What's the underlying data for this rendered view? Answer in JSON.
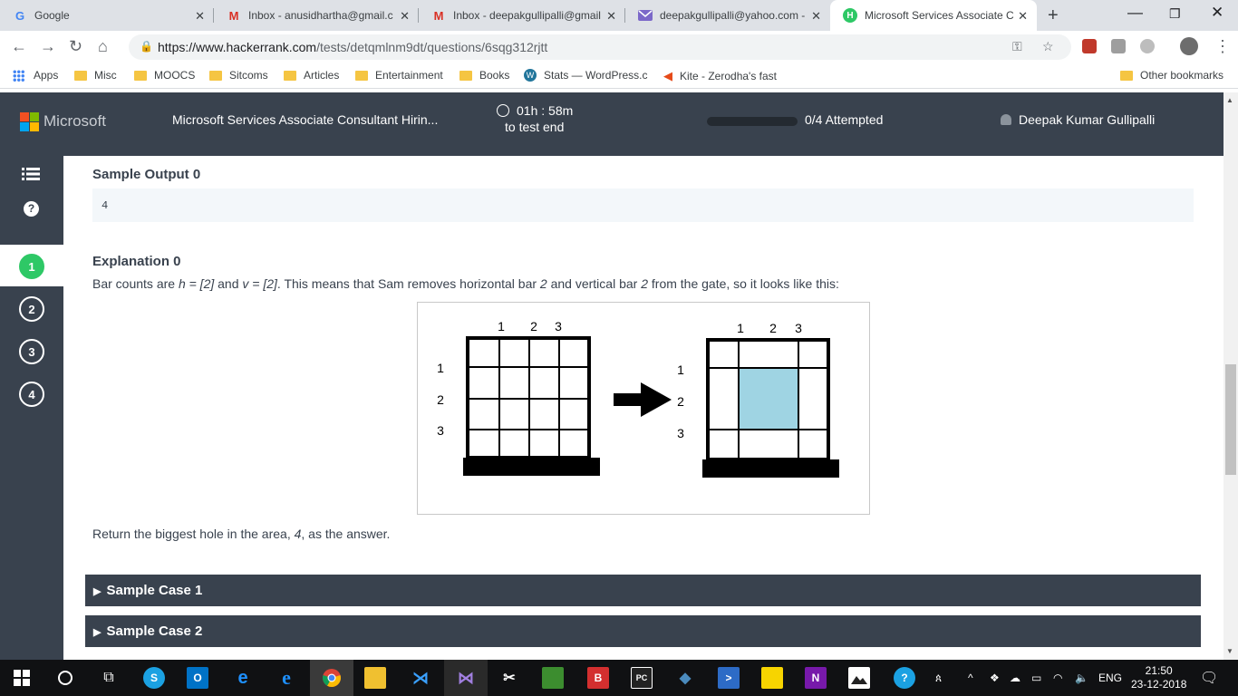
{
  "browser": {
    "tabs": [
      {
        "title": "Google",
        "icon": "google-g-icon"
      },
      {
        "title": "Inbox - anusidhartha@gmail.co",
        "icon": "gmail-icon"
      },
      {
        "title": "Inbox - deepakgullipalli@gmail",
        "icon": "gmail-icon"
      },
      {
        "title": "deepakgullipalli@yahoo.com -",
        "icon": "yahoo-mail-icon"
      },
      {
        "title": "Microsoft Services Associate C",
        "icon": "hackerrank-icon"
      }
    ],
    "url_host": "https://www.hackerrank.com",
    "url_path": "/tests/detqmlnm9dt/questions/6sqg312rjtt",
    "bookmarks": [
      "Apps",
      "Misc",
      "MOOCS",
      "Sitcoms",
      "Articles",
      "Entertainment",
      "Books",
      "Stats — WordPress.c",
      "Kite - Zerodha's fast"
    ],
    "other_bookmarks": "Other bookmarks"
  },
  "header": {
    "brand": "Microsoft",
    "test_title": "Microsoft Services Associate Consultant Hirin...",
    "timer": "01h : 58m",
    "timer_sub": "to test end",
    "progress": 0.0,
    "attempted": "0/4 Attempted",
    "user": "Deepak Kumar Gullipalli"
  },
  "sidebar": {
    "questions": [
      "1",
      "2",
      "3",
      "4"
    ],
    "active_question": "1"
  },
  "main": {
    "sample_output_title": "Sample Output 0",
    "sample_output_value": "4",
    "explanation_title": "Explanation 0",
    "explanation_parts": {
      "p1": "Bar counts are ",
      "h": "h = [2]",
      "p2": " and ",
      "v": "v = [2]",
      "p3": ". This means that Sam removes horizontal bar ",
      "n1": "2",
      "p4": " and vertical bar ",
      "n2": "2",
      "p5": " from the gate, so it looks like this:"
    },
    "figure": {
      "col_labels": [
        "1",
        "2",
        "3"
      ],
      "row_labels": [
        "1",
        "2",
        "3"
      ],
      "hole_color": "#9fd4e3"
    },
    "result_parts": {
      "p1": "Return the biggest hole in the area, ",
      "n": "4",
      "p2": ", as the answer."
    },
    "sample_cases": [
      "Sample Case 1",
      "Sample Case 2"
    ]
  },
  "taskbar": {
    "lang": "ENG",
    "time": "21:50",
    "date": "23-12-2018"
  },
  "colors": {
    "header_bg": "#39424e",
    "active_green": "#2ec866"
  }
}
